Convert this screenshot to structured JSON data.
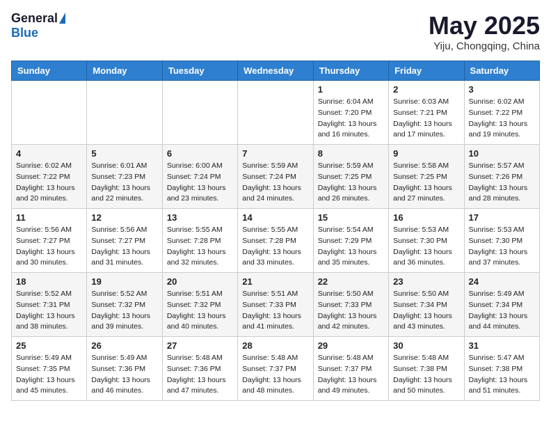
{
  "header": {
    "logo_general": "General",
    "logo_blue": "Blue",
    "month": "May 2025",
    "location": "Yiju, Chongqing, China"
  },
  "weekdays": [
    "Sunday",
    "Monday",
    "Tuesday",
    "Wednesday",
    "Thursday",
    "Friday",
    "Saturday"
  ],
  "weeks": [
    [
      {
        "day": "",
        "info": ""
      },
      {
        "day": "",
        "info": ""
      },
      {
        "day": "",
        "info": ""
      },
      {
        "day": "",
        "info": ""
      },
      {
        "day": "1",
        "info": "Sunrise: 6:04 AM\nSunset: 7:20 PM\nDaylight: 13 hours\nand 16 minutes."
      },
      {
        "day": "2",
        "info": "Sunrise: 6:03 AM\nSunset: 7:21 PM\nDaylight: 13 hours\nand 17 minutes."
      },
      {
        "day": "3",
        "info": "Sunrise: 6:02 AM\nSunset: 7:22 PM\nDaylight: 13 hours\nand 19 minutes."
      }
    ],
    [
      {
        "day": "4",
        "info": "Sunrise: 6:02 AM\nSunset: 7:22 PM\nDaylight: 13 hours\nand 20 minutes."
      },
      {
        "day": "5",
        "info": "Sunrise: 6:01 AM\nSunset: 7:23 PM\nDaylight: 13 hours\nand 22 minutes."
      },
      {
        "day": "6",
        "info": "Sunrise: 6:00 AM\nSunset: 7:24 PM\nDaylight: 13 hours\nand 23 minutes."
      },
      {
        "day": "7",
        "info": "Sunrise: 5:59 AM\nSunset: 7:24 PM\nDaylight: 13 hours\nand 24 minutes."
      },
      {
        "day": "8",
        "info": "Sunrise: 5:59 AM\nSunset: 7:25 PM\nDaylight: 13 hours\nand 26 minutes."
      },
      {
        "day": "9",
        "info": "Sunrise: 5:58 AM\nSunset: 7:25 PM\nDaylight: 13 hours\nand 27 minutes."
      },
      {
        "day": "10",
        "info": "Sunrise: 5:57 AM\nSunset: 7:26 PM\nDaylight: 13 hours\nand 28 minutes."
      }
    ],
    [
      {
        "day": "11",
        "info": "Sunrise: 5:56 AM\nSunset: 7:27 PM\nDaylight: 13 hours\nand 30 minutes."
      },
      {
        "day": "12",
        "info": "Sunrise: 5:56 AM\nSunset: 7:27 PM\nDaylight: 13 hours\nand 31 minutes."
      },
      {
        "day": "13",
        "info": "Sunrise: 5:55 AM\nSunset: 7:28 PM\nDaylight: 13 hours\nand 32 minutes."
      },
      {
        "day": "14",
        "info": "Sunrise: 5:55 AM\nSunset: 7:28 PM\nDaylight: 13 hours\nand 33 minutes."
      },
      {
        "day": "15",
        "info": "Sunrise: 5:54 AM\nSunset: 7:29 PM\nDaylight: 13 hours\nand 35 minutes."
      },
      {
        "day": "16",
        "info": "Sunrise: 5:53 AM\nSunset: 7:30 PM\nDaylight: 13 hours\nand 36 minutes."
      },
      {
        "day": "17",
        "info": "Sunrise: 5:53 AM\nSunset: 7:30 PM\nDaylight: 13 hours\nand 37 minutes."
      }
    ],
    [
      {
        "day": "18",
        "info": "Sunrise: 5:52 AM\nSunset: 7:31 PM\nDaylight: 13 hours\nand 38 minutes."
      },
      {
        "day": "19",
        "info": "Sunrise: 5:52 AM\nSunset: 7:32 PM\nDaylight: 13 hours\nand 39 minutes."
      },
      {
        "day": "20",
        "info": "Sunrise: 5:51 AM\nSunset: 7:32 PM\nDaylight: 13 hours\nand 40 minutes."
      },
      {
        "day": "21",
        "info": "Sunrise: 5:51 AM\nSunset: 7:33 PM\nDaylight: 13 hours\nand 41 minutes."
      },
      {
        "day": "22",
        "info": "Sunrise: 5:50 AM\nSunset: 7:33 PM\nDaylight: 13 hours\nand 42 minutes."
      },
      {
        "day": "23",
        "info": "Sunrise: 5:50 AM\nSunset: 7:34 PM\nDaylight: 13 hours\nand 43 minutes."
      },
      {
        "day": "24",
        "info": "Sunrise: 5:49 AM\nSunset: 7:34 PM\nDaylight: 13 hours\nand 44 minutes."
      }
    ],
    [
      {
        "day": "25",
        "info": "Sunrise: 5:49 AM\nSunset: 7:35 PM\nDaylight: 13 hours\nand 45 minutes."
      },
      {
        "day": "26",
        "info": "Sunrise: 5:49 AM\nSunset: 7:36 PM\nDaylight: 13 hours\nand 46 minutes."
      },
      {
        "day": "27",
        "info": "Sunrise: 5:48 AM\nSunset: 7:36 PM\nDaylight: 13 hours\nand 47 minutes."
      },
      {
        "day": "28",
        "info": "Sunrise: 5:48 AM\nSunset: 7:37 PM\nDaylight: 13 hours\nand 48 minutes."
      },
      {
        "day": "29",
        "info": "Sunrise: 5:48 AM\nSunset: 7:37 PM\nDaylight: 13 hours\nand 49 minutes."
      },
      {
        "day": "30",
        "info": "Sunrise: 5:48 AM\nSunset: 7:38 PM\nDaylight: 13 hours\nand 50 minutes."
      },
      {
        "day": "31",
        "info": "Sunrise: 5:47 AM\nSunset: 7:38 PM\nDaylight: 13 hours\nand 51 minutes."
      }
    ]
  ]
}
